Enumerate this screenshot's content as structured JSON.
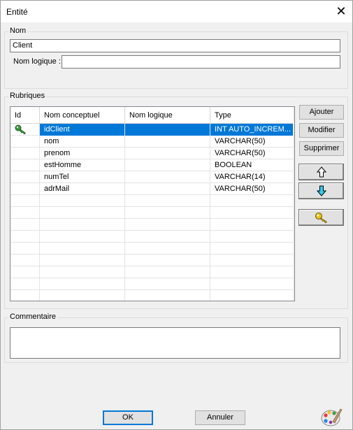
{
  "window": {
    "title": "Entité",
    "close_glyph": "✕"
  },
  "name_group": {
    "legend": "Nom",
    "name_value": "Client",
    "logical_label": "Nom logique :",
    "logical_value": ""
  },
  "fields_group": {
    "legend": "Rubriques",
    "columns": [
      "Id",
      "Nom conceptuel",
      "Nom logique",
      "Type"
    ],
    "rows": [
      {
        "id_key": true,
        "concept": "idClient",
        "logical": "",
        "type": "INT AUTO_INCREM...",
        "selected": true
      },
      {
        "id_key": false,
        "concept": "nom",
        "logical": "",
        "type": "VARCHAR(50)"
      },
      {
        "id_key": false,
        "concept": "prenom",
        "logical": "",
        "type": "VARCHAR(50)"
      },
      {
        "id_key": false,
        "concept": "estHomme",
        "logical": "",
        "type": "BOOLEAN"
      },
      {
        "id_key": false,
        "concept": "numTel",
        "logical": "",
        "type": "VARCHAR(14)"
      },
      {
        "id_key": false,
        "concept": "adrMail",
        "logical": "",
        "type": "VARCHAR(50)"
      }
    ],
    "buttons": {
      "add": "Ajouter",
      "edit": "Modifier",
      "delete": "Supprimer"
    },
    "icons": {
      "up": "arrow-up-icon",
      "down": "arrow-down-icon",
      "key": "key-icon"
    }
  },
  "comment_group": {
    "legend": "Commentaire",
    "value": ""
  },
  "footer": {
    "ok": "OK",
    "cancel": "Annuler"
  },
  "colors": {
    "selection": "#0078d7",
    "arrow_fill": "#33ccee",
    "key_gold": "#e8c21a",
    "key_green": "#3a9a3a"
  }
}
